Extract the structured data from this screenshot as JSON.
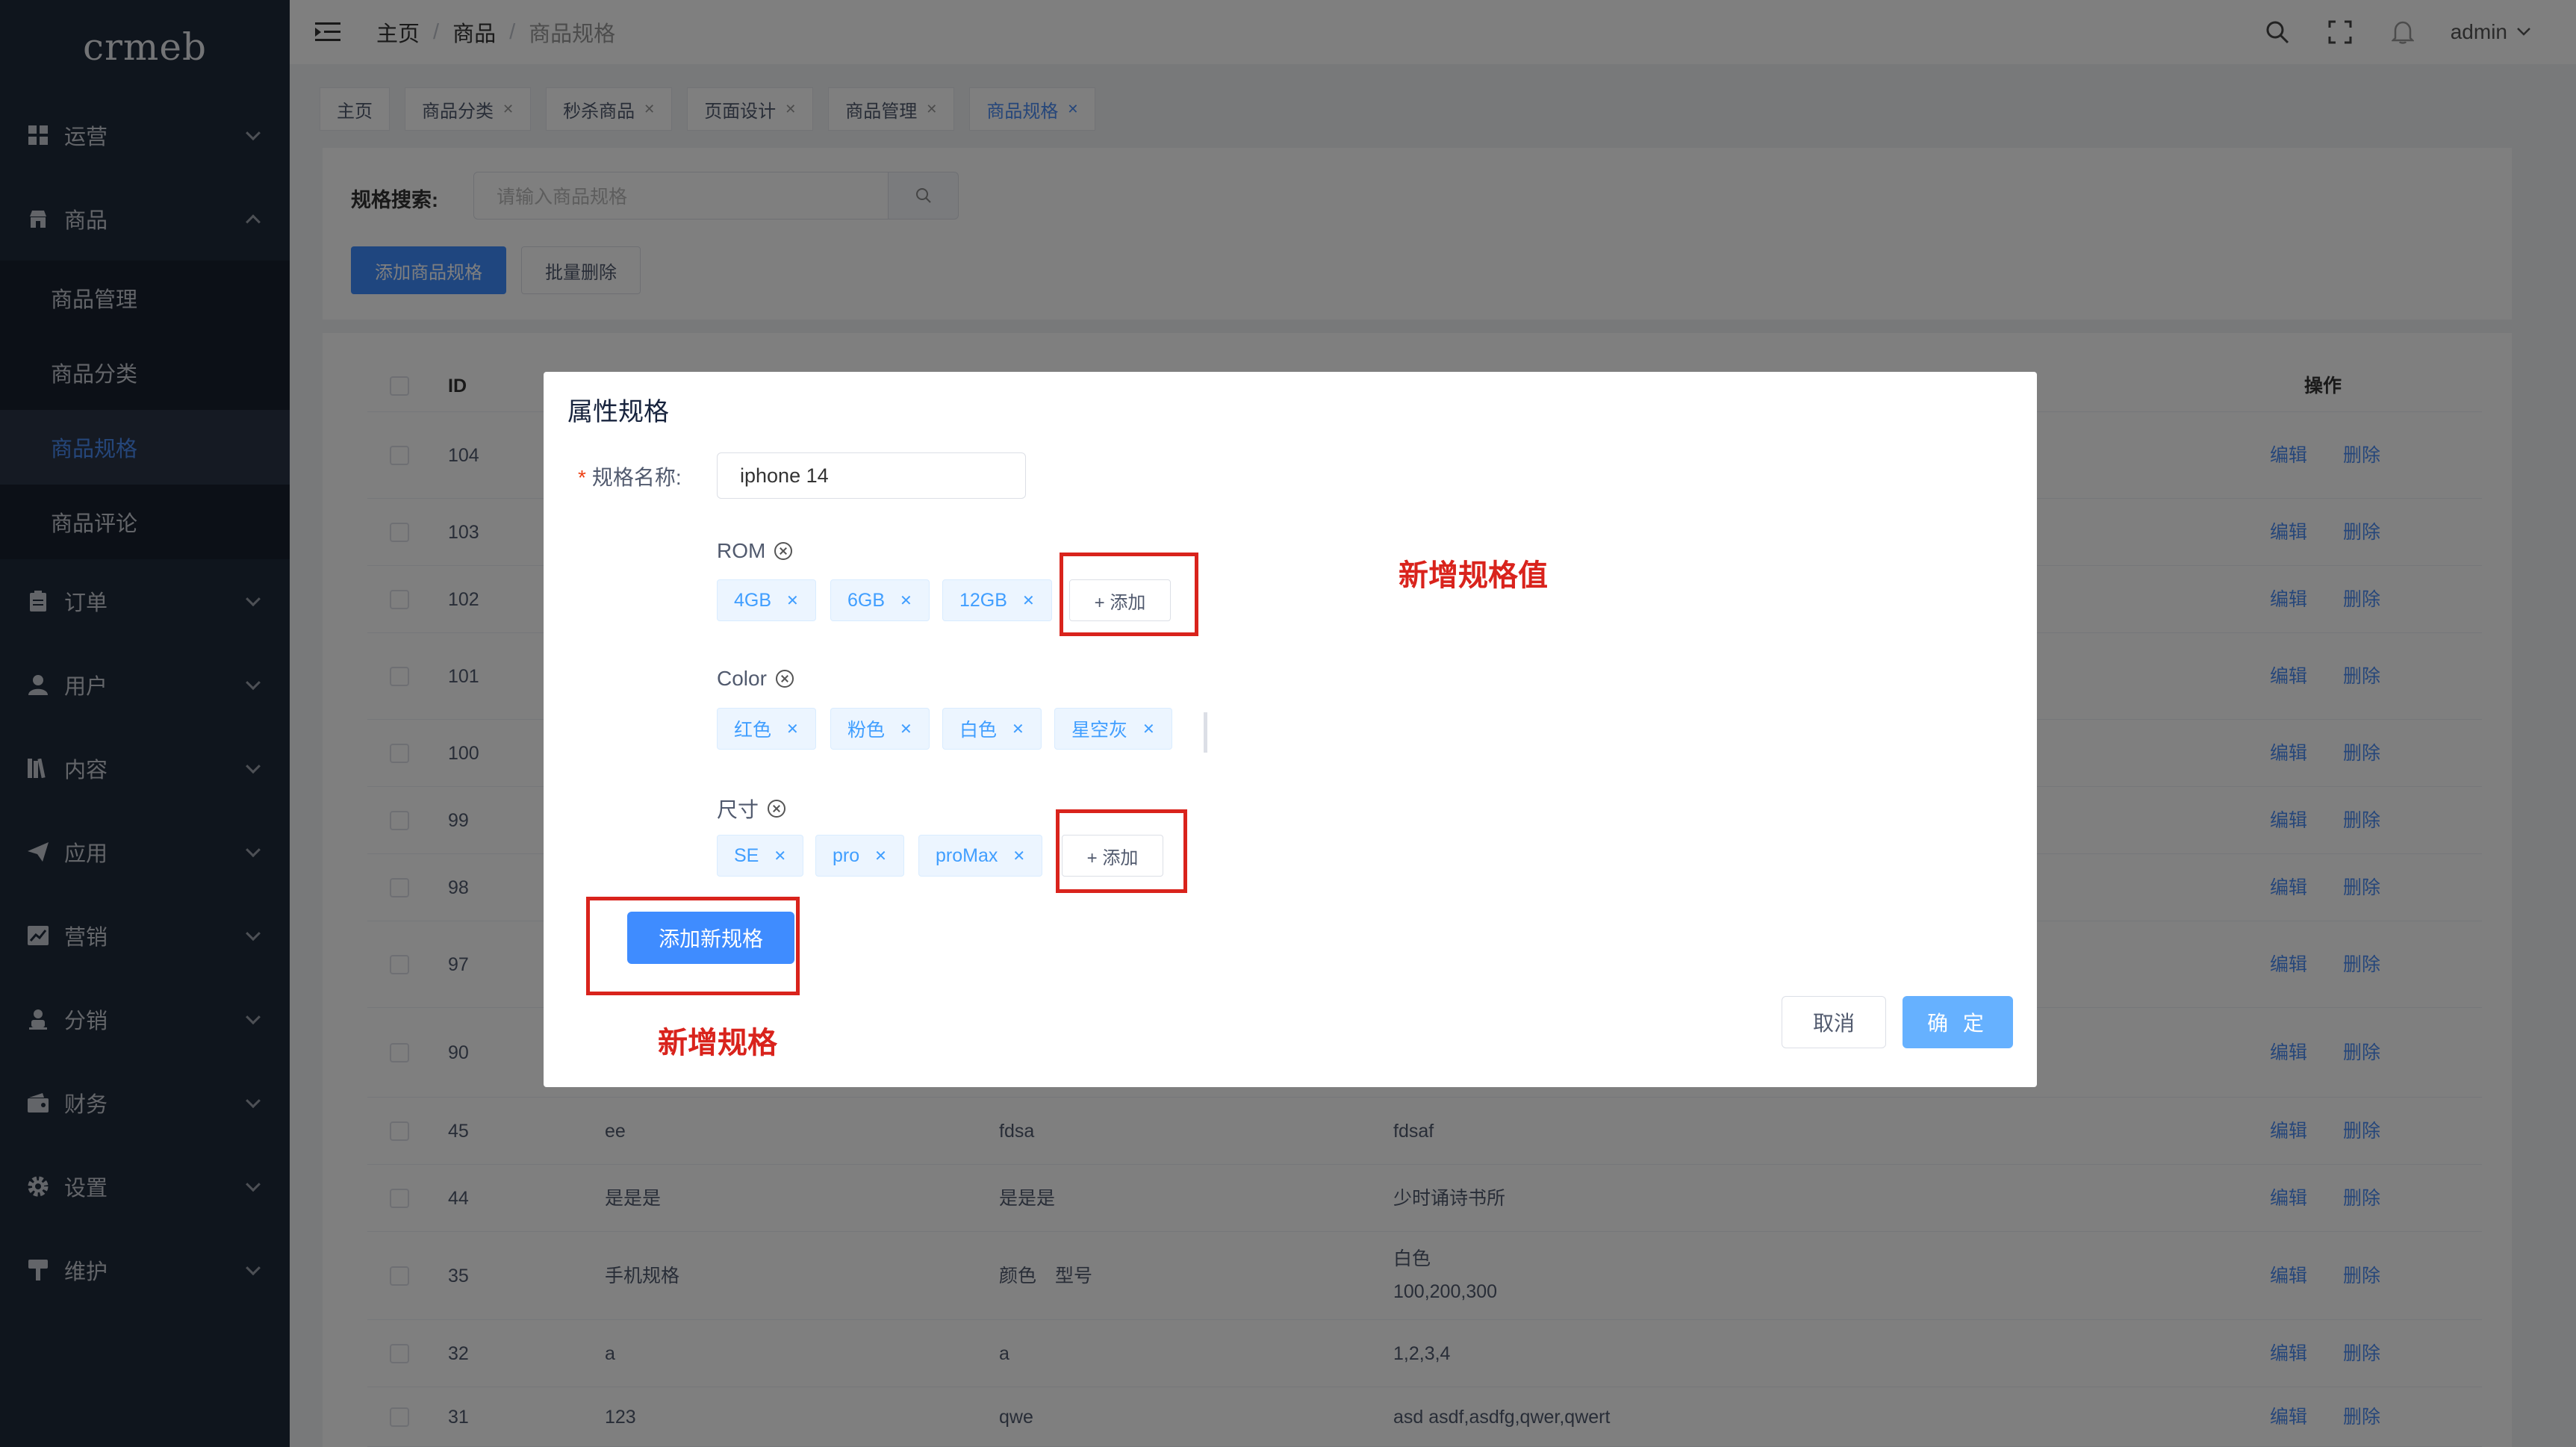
{
  "app": {
    "logo": "crmeb"
  },
  "sidebar": {
    "items": [
      {
        "label": "运营",
        "icon": "grid-icon"
      },
      {
        "label": "商品",
        "icon": "shop-icon",
        "expanded": true,
        "children": [
          "商品管理",
          "商品分类",
          "商品规格",
          "商品评论"
        ],
        "active_child": "商品规格"
      },
      {
        "label": "订单",
        "icon": "clipboard-icon"
      },
      {
        "label": "用户",
        "icon": "user-icon"
      },
      {
        "label": "内容",
        "icon": "books-icon"
      },
      {
        "label": "应用",
        "icon": "paper-plane-icon"
      },
      {
        "label": "营销",
        "icon": "chart-icon"
      },
      {
        "label": "分销",
        "icon": "person-icon"
      },
      {
        "label": "财务",
        "icon": "wallet-icon"
      },
      {
        "label": "设置",
        "icon": "gear-icon"
      },
      {
        "label": "维护",
        "icon": "hammer-icon"
      }
    ]
  },
  "header": {
    "breadcrumb": [
      "主页",
      "商品",
      "商品规格"
    ],
    "user": "admin"
  },
  "tabs": [
    {
      "label": "主页",
      "closable": false
    },
    {
      "label": "商品分类",
      "closable": true
    },
    {
      "label": "秒杀商品",
      "closable": true
    },
    {
      "label": "页面设计",
      "closable": true
    },
    {
      "label": "商品管理",
      "closable": true
    },
    {
      "label": "商品规格",
      "closable": true,
      "active": true
    }
  ],
  "search": {
    "label": "规格搜索:",
    "placeholder": "请输入商品规格",
    "add_button": "添加商品规格",
    "batch_delete_button": "批量删除"
  },
  "table": {
    "headers": {
      "id": "ID",
      "actions": "操作"
    },
    "action_edit": "编辑",
    "action_delete": "删除",
    "rows": [
      {
        "id": "104",
        "name": "",
        "attr": "",
        "values": ""
      },
      {
        "id": "103",
        "name": "",
        "attr": "",
        "values": ""
      },
      {
        "id": "102",
        "name": "",
        "attr": "",
        "values": ""
      },
      {
        "id": "101",
        "name": "",
        "attr": "",
        "values": ""
      },
      {
        "id": "100",
        "name": "",
        "attr": "",
        "values": ""
      },
      {
        "id": "99",
        "name": "",
        "attr": "",
        "values": ""
      },
      {
        "id": "98",
        "name": "",
        "attr": "",
        "values": ""
      },
      {
        "id": "97",
        "name": "",
        "attr": "",
        "values": ""
      },
      {
        "id": "90",
        "name": "",
        "attr": "",
        "values": ""
      },
      {
        "id": "45",
        "name": "ee",
        "attr": "fdsa",
        "values": "fdsaf"
      },
      {
        "id": "44",
        "name": "是是是",
        "attr": "是是是",
        "values": "少时诵诗书所"
      },
      {
        "id": "35",
        "name": "手机规格",
        "attr": "颜色　型号",
        "values": "白色",
        "values2": "100,200,300"
      },
      {
        "id": "32",
        "name": "a",
        "attr": "a",
        "values": "1,2,3,4"
      },
      {
        "id": "31",
        "name": "123",
        "attr": "qwe",
        "values": "asd asdf,asdfg,qwer,qwert"
      }
    ]
  },
  "modal": {
    "title": "属性规格",
    "name_label": "规格名称:",
    "name_required_mark": "*",
    "name_value": "iphone 14",
    "groups": [
      {
        "title": "ROM",
        "values": [
          "4GB",
          "6GB",
          "12GB"
        ],
        "has_add": true
      },
      {
        "title": "Color",
        "values": [
          "红色",
          "粉色",
          "白色",
          "星空灰"
        ],
        "has_add": false
      },
      {
        "title": "尺寸",
        "values": [
          "SE",
          "pro",
          "proMax"
        ],
        "has_add": true
      }
    ],
    "add_value_button": "+ 添加",
    "add_spec_button": "添加新规格",
    "cancel_button": "取消",
    "ok_button": "确 定"
  },
  "annotations": {
    "new_value": "新增规格值",
    "new_spec": "新增规格",
    "color": "#d9231c"
  },
  "colors": {
    "primary": "#3f8cff",
    "sidebar_bg": "#1f2a3b",
    "active_link": "#4b8cf5"
  }
}
